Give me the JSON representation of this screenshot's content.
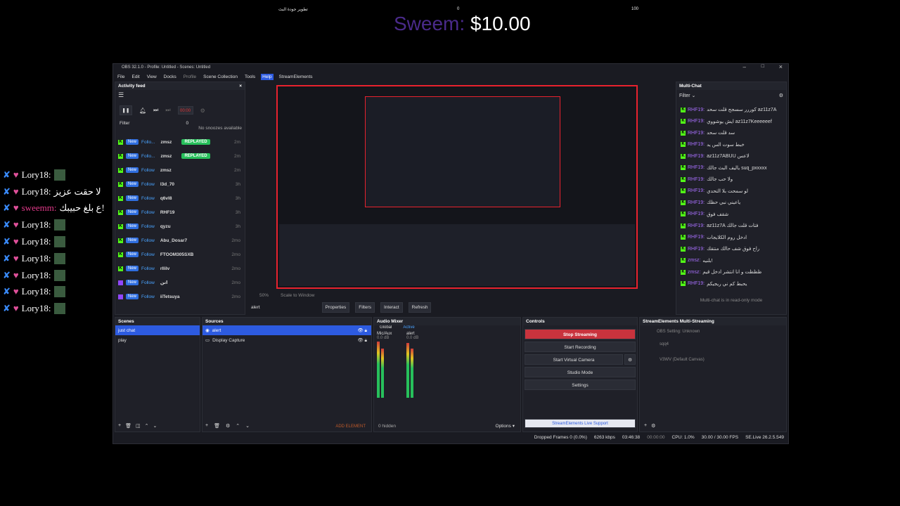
{
  "overlay": {
    "top_left_text": "تطوير جودة البث",
    "top_mid_value": "0",
    "top_right_value": "100",
    "donation_name": "Sweem:",
    "donation_amount": "$10.00",
    "chat_lines": [
      {
        "user": "Lory18:",
        "msg": ""
      },
      {
        "user": "Lory18:",
        "msg": "لا حقت عزيز"
      },
      {
        "user": "sweemm:",
        "msg": "ع بلغ حبيبك!"
      },
      {
        "user": "Lory18:",
        "msg": ""
      },
      {
        "user": "Lory18:",
        "msg": ""
      },
      {
        "user": "Lory18:",
        "msg": ""
      },
      {
        "user": "Lory18:",
        "msg": ""
      },
      {
        "user": "Lory18:",
        "msg": ""
      },
      {
        "user": "Lory18:",
        "msg": ""
      }
    ]
  },
  "window": {
    "title": "OBS 32.1.0 - Profile: Untitled - Scenes: Untitled",
    "menu": [
      "File",
      "Edit",
      "View",
      "Docks",
      "Profile",
      "Scene Collection",
      "Tools",
      "Help",
      "StreamElements"
    ]
  },
  "activity_feed": {
    "title": "Activity feed",
    "timer": "00:00",
    "filter": "Filter",
    "count": "0",
    "no_snoozes": "No snoozes available",
    "items": [
      {
        "platform": "k",
        "new": "New",
        "action": "Follo...",
        "user": "zmsz",
        "replayed": "REPLAYED",
        "time": "2m"
      },
      {
        "platform": "k",
        "new": "New",
        "action": "Follo...",
        "user": "zmsz",
        "replayed": "REPLAYED",
        "time": "2m"
      },
      {
        "platform": "k",
        "new": "New",
        "action": "Follow",
        "user": "zmsz",
        "replayed": "",
        "time": "2m"
      },
      {
        "platform": "k",
        "new": "New",
        "action": "Follow",
        "user": "l3d_70",
        "replayed": "",
        "time": "3h"
      },
      {
        "platform": "k",
        "new": "New",
        "action": "Follow",
        "user": "q6vl8",
        "replayed": "",
        "time": "3h"
      },
      {
        "platform": "k",
        "new": "New",
        "action": "Follow",
        "user": "RHF19",
        "replayed": "",
        "time": "3h"
      },
      {
        "platform": "k",
        "new": "New",
        "action": "Follow",
        "user": "qyzu",
        "replayed": "",
        "time": "3h"
      },
      {
        "platform": "k",
        "new": "New",
        "action": "Follow",
        "user": "Abu_Dosar7",
        "replayed": "",
        "time": "2mo"
      },
      {
        "platform": "k",
        "new": "New",
        "action": "Follow",
        "user": "FTOOM305SXB",
        "replayed": "",
        "time": "2mo"
      },
      {
        "platform": "k",
        "new": "New",
        "action": "Follow",
        "user": "rllilv",
        "replayed": "",
        "time": "2mo"
      },
      {
        "platform": "t",
        "new": "New",
        "action": "Follow",
        "user": "اتن",
        "replayed": "",
        "time": "2mo"
      },
      {
        "platform": "t",
        "new": "New",
        "action": "Follow",
        "user": "iiTetsuya",
        "replayed": "",
        "time": "2mo"
      }
    ]
  },
  "preview": {
    "source_name": "alert",
    "btn_properties": "Properties",
    "btn_filters": "Filters",
    "btn_interact": "Interact",
    "btn_refresh": "Refresh",
    "zoom": "50%",
    "scale_label": "Scale to Window"
  },
  "multichat": {
    "title": "Multi-Chat",
    "filter": "Filter",
    "readonly": "Multi-chat is in read-only mode",
    "messages": [
      {
        "user": "RHF19:",
        "msg": "كوررر سسجح قلت سحد az11z7A"
      },
      {
        "user": "RHF19:",
        "msg": "ايش يوشووي az11z7Keeeeeef"
      },
      {
        "user": "RHF19:",
        "msg": "سد قلت سحد"
      },
      {
        "user": "RHF19:",
        "msg": "خبط سوت الس يد"
      },
      {
        "user": "RHF19:",
        "msg": "az11z7ABUU لاعس"
      },
      {
        "user": "RHF19:",
        "msg": "ياليف البث جالك suq_pxxxxx"
      },
      {
        "user": "RHF19:",
        "msg": "ولا حب جالك"
      },
      {
        "user": "RHF19:",
        "msg": "لو سمحت بلا التحدي"
      },
      {
        "user": "RHF19:",
        "msg": "ياعيني نبي حظك"
      },
      {
        "user": "RHF19:",
        "msg": "شقف فوق"
      },
      {
        "user": "RHF19:",
        "msg": "az11z7A فتات قلت جالك"
      },
      {
        "user": "RHF19:",
        "msg": "ادخل روم الكلايجات"
      },
      {
        "user": "RHF19:",
        "msg": "راح فوق شف حالك منتقك"
      },
      {
        "user": "zmsz:",
        "msg": "بلنيه!"
      },
      {
        "user": "zmsz:",
        "msg": "ظظظت و انا انتشر ادخل قيم"
      },
      {
        "user": "RHF19:",
        "msg": "يحبط كم ني ريجيكم"
      }
    ]
  },
  "scenes": {
    "title": "Scenes",
    "items": [
      "just chat",
      "play"
    ]
  },
  "sources": {
    "title": "Sources",
    "items": [
      "alert",
      "Display Capture"
    ],
    "add_element": "ADD ELEMENT"
  },
  "audio_mixer": {
    "title": "Audio Mixer",
    "tab_global": "Global",
    "tab_active": "Active",
    "channels": [
      {
        "name": "Mic/Aux",
        "db": "0.0 dB"
      },
      {
        "name": "alert",
        "db": "0.0 dB"
      }
    ],
    "hidden": "0 hidden",
    "options": "Options"
  },
  "controls": {
    "title": "Controls",
    "stop_streaming": "Stop Streaming",
    "start_recording": "Start Recording",
    "start_virtual_camera": "Start Virtual Camera",
    "studio_mode": "Studio Mode",
    "settings": "Settings",
    "live_support": "StreamElements Live Support"
  },
  "multistream": {
    "title": "StreamElements Multi-Streaming",
    "obs_setting": "OBS Setting: Unknown",
    "target1": "sqq4",
    "target2": "V3WV (Default Canvas)"
  },
  "statusbar": {
    "dropped": "Dropped Frames 0 (0.0%)",
    "kbps": "6263 kbps",
    "stream_time": "03:46:38",
    "rec_time": "00:00:00",
    "cpu": "CPU: 1.0%",
    "fps": "30.00 / 30.00 FPS",
    "version": "SE.Live 26.2.5.549"
  },
  "colors": {
    "accent": "#2d5be0",
    "live_red": "#c9333d",
    "kick_green": "#53fc18",
    "twitch_purple": "#9146ff"
  }
}
